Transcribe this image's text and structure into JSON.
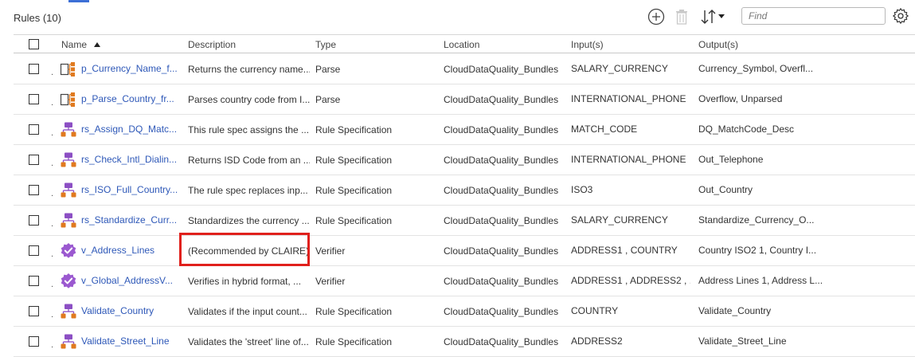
{
  "title": "Rules (10)",
  "search": {
    "placeholder": "Find"
  },
  "toolbar": {
    "add_icon": "plus-circle-icon",
    "delete_icon": "trash-icon",
    "sort_icon": "sort-icon",
    "settings_icon": "gear-icon"
  },
  "columns": {
    "name": "Name",
    "description": "Description",
    "type": "Type",
    "location": "Location",
    "inputs": "Input(s)",
    "outputs": "Output(s)"
  },
  "colors": {
    "link": "#2e58b8",
    "parse_icon": "#e07a1f",
    "rulespec_top": "#8c4fc4",
    "rulespec_bottom": "#e07a1f",
    "verifier": "#9b59d0",
    "highlight": "#e0201c"
  },
  "rows": [
    {
      "icon": "parse",
      "name": "p_Currency_Name_f...",
      "description": "Returns the currency name...",
      "type": "Parse",
      "location": "CloudDataQuality_Bundles",
      "inputs": "SALARY_CURRENCY",
      "outputs": "Currency_Symbol, Overfl..."
    },
    {
      "icon": "parse",
      "name": "p_Parse_Country_fr...",
      "description": "Parses country code from I...",
      "type": "Parse",
      "location": "CloudDataQuality_Bundles",
      "inputs": "INTERNATIONAL_PHONE",
      "outputs": "Overflow, Unparsed"
    },
    {
      "icon": "rulespec",
      "name": "rs_Assign_DQ_Matc...",
      "description": "This rule spec assigns the ...",
      "type": "Rule Specification",
      "location": "CloudDataQuality_Bundles",
      "inputs": "MATCH_CODE",
      "outputs": "DQ_MatchCode_Desc"
    },
    {
      "icon": "rulespec",
      "name": "rs_Check_Intl_Dialin...",
      "description": "Returns ISD Code from an ...",
      "type": "Rule Specification",
      "location": "CloudDataQuality_Bundles",
      "inputs": "INTERNATIONAL_PHONE",
      "outputs": "Out_Telephone"
    },
    {
      "icon": "rulespec",
      "name": "rs_ISO_Full_Country...",
      "description": "The rule spec replaces inp...",
      "type": "Rule Specification",
      "location": "CloudDataQuality_Bundles",
      "inputs": "ISO3",
      "outputs": "Out_Country"
    },
    {
      "icon": "rulespec",
      "name": "rs_Standardize_Curr...",
      "description": "Standardizes the currency ...",
      "type": "Rule Specification",
      "location": "CloudDataQuality_Bundles",
      "inputs": "SALARY_CURRENCY",
      "outputs": "Standardize_Currency_O..."
    },
    {
      "icon": "verifier",
      "name": "v_Address_Lines",
      "description": "(Recommended by CLAIRE)",
      "type": "Verifier",
      "location": "CloudDataQuality_Bundles",
      "inputs": "ADDRESS1 , COUNTRY",
      "outputs": "Country ISO2 1, Country I..."
    },
    {
      "icon": "verifier",
      "name": "v_Global_AddressV...",
      "description": "Verifies in hybrid format, ...",
      "type": "Verifier",
      "location": "CloudDataQuality_Bundles",
      "inputs": "ADDRESS1 , ADDRESS2 , ...",
      "outputs": "Address Lines 1, Address L..."
    },
    {
      "icon": "rulespec",
      "name": "Validate_Country",
      "description": "Validates if the input count...",
      "type": "Rule Specification",
      "location": "CloudDataQuality_Bundles",
      "inputs": "COUNTRY",
      "outputs": "Validate_Country"
    },
    {
      "icon": "rulespec",
      "name": "Validate_Street_Line",
      "description": "Validates the 'street' line of...",
      "type": "Rule Specification",
      "location": "CloudDataQuality_Bundles",
      "inputs": "ADDRESS2",
      "outputs": "Validate_Street_Line"
    }
  ]
}
